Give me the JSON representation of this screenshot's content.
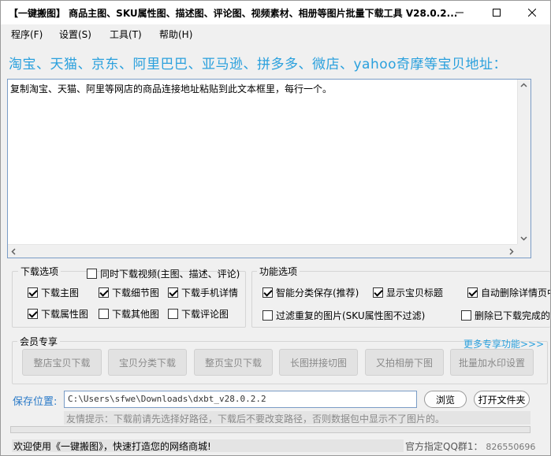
{
  "window": {
    "title": "【一键搬图】 商品主图、SKU属性图、描述图、评论图、视频素材、相册等图片批量下载工具 V28.0.2..."
  },
  "menu": {
    "items": [
      "程序(F)",
      "设置(S)",
      "工具(T)",
      "帮助(H)"
    ]
  },
  "heading": "淘宝、天猫、京东、阿里巴巴、亚马逊、拼多多、微店、yahoo奇摩等宝贝地址：",
  "url_input": {
    "placeholder_text": "复制淘宝、天猫、阿里等网店的商品连接地址粘贴到此文本框里，每行一个。"
  },
  "download_options": {
    "label": "下载选项",
    "video_option": {
      "label": "同时下载视频(主图、描述、评论)",
      "checked": false
    },
    "options": [
      {
        "label": "下载主图",
        "checked": true
      },
      {
        "label": "下载细节图",
        "checked": true
      },
      {
        "label": "下载手机详情",
        "checked": true
      },
      {
        "label": "下载属性图",
        "checked": true
      },
      {
        "label": "下载其他图",
        "checked": false
      },
      {
        "label": "下载评论图",
        "checked": false
      }
    ]
  },
  "function_options": {
    "label": "功能选项",
    "options": [
      {
        "label": "智能分类保存(推荐)",
        "checked": true
      },
      {
        "label": "显示宝贝标题",
        "checked": true
      },
      {
        "label": "自动删除详情页中",
        "checked": true
      },
      {
        "label": "过滤重复的图片(SKU属性图不过滤)",
        "checked": false
      },
      {
        "label": "删除已下载完成的",
        "checked": false
      }
    ]
  },
  "member": {
    "label": "会员专享",
    "more_link": "更多专享功能>>>",
    "buttons": [
      "整店宝贝下载",
      "宝贝分类下载",
      "整页宝贝下载",
      "长图拼接切图",
      "又拍相册下图",
      "批量加水印设置"
    ]
  },
  "save": {
    "label": "保存位置:",
    "path": "C:\\Users\\sfwe\\Downloads\\dxbt_v28.0.2.2",
    "browse_label": "浏览",
    "open_folder_label": "打开文件夹"
  },
  "tip": "友情提示：下载前请先选择好路径，下载后不要改变路径，否则数据包中显示不了图片的。",
  "progress": 0,
  "status": {
    "welcome": "欢迎使用《一键搬图》，快速打造您的网络商城!",
    "qq_label": "官方指定QQ群1：",
    "qq_number": "826550696"
  },
  "colors": {
    "accent_blue": "#2aa0dd",
    "save_label_blue": "#2a7ac8",
    "disabled_text": "#8a8a8a"
  },
  "icons": {
    "minimize": "minimize-icon",
    "maximize": "maximize-icon",
    "close": "close-icon"
  }
}
